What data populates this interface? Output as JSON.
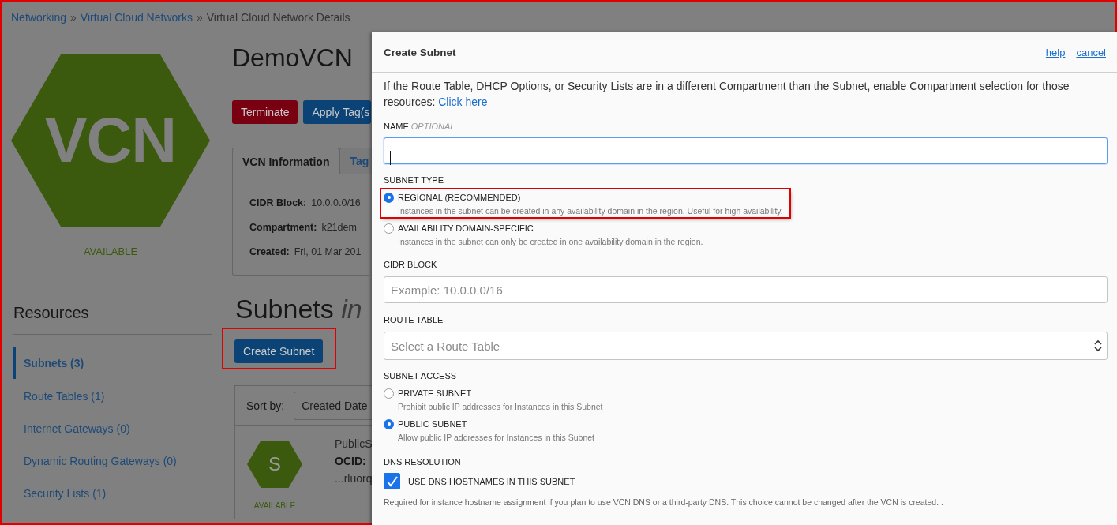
{
  "annotation_frame": true,
  "breadcrumb": [
    {
      "kind": "link",
      "text": "Networking"
    },
    {
      "kind": "separator",
      "text": "»"
    },
    {
      "kind": "link",
      "text": "Virtual Cloud Networks"
    },
    {
      "kind": "separator",
      "text": "»"
    },
    {
      "kind": "current",
      "text": "Virtual Cloud Network Details"
    }
  ],
  "vcn": {
    "logo_text": "VCN",
    "status": "AVAILABLE",
    "name": "DemoVCN",
    "actions": [
      {
        "label": "Terminate",
        "kind": "danger"
      },
      {
        "label": "Apply Tag(s",
        "kind": "primary"
      }
    ],
    "tabs": [
      {
        "label": "VCN Information",
        "selected": true
      },
      {
        "label": "Tag",
        "selected": false
      }
    ],
    "details": [
      {
        "label": "CIDR Block:",
        "value": "10.0.0.0/16"
      },
      {
        "label": "Compartment:",
        "value": "k21dem"
      },
      {
        "label": "Created:",
        "value": "Fri, 01 Mar 201"
      }
    ]
  },
  "resources": {
    "title": "Resources",
    "items": [
      {
        "label": "Subnets (3)",
        "selected": true
      },
      {
        "label": "Route Tables (1)",
        "selected": false
      },
      {
        "label": "Internet Gateways (0)",
        "selected": false
      },
      {
        "label": "Dynamic Routing Gateways (0)",
        "selected": false
      },
      {
        "label": "Security Lists (1)",
        "selected": false
      }
    ]
  },
  "subnets": {
    "title": "Subnets *in*",
    "create_button": {
      "label": "Create Subnet",
      "highlighted": true
    },
    "sort_label": "Sort by:",
    "sort_value": "Created Date",
    "rows": [
      {
        "badge": "S",
        "name": "PublicS",
        "ocid_label": "OCID:",
        "ocid": "...rluorq",
        "status": "AVAILABLE"
      }
    ]
  },
  "modal": {
    "title": "Create Subnet",
    "links": [
      "help",
      "cancel"
    ],
    "intro": "If the Route Table, DHCP Options, or Security Lists are in a different Compartment than the Subnet, enable Compartment selection for those resources:",
    "intro_link": "Click here",
    "fields": [
      {
        "kind": "text",
        "label": "NAME",
        "optional": "OPTIONAL",
        "focused": true
      },
      {
        "kind": "radio",
        "label": "SUBNET TYPE",
        "options": [
          {
            "label": "REGIONAL (RECOMMENDED)",
            "description": "Instances in the subnet can be created in any availability domain in the region. Useful for high availability.",
            "selected": true,
            "highlighted": true
          },
          {
            "label": "AVAILABILITY DOMAIN-SPECIFIC",
            "description": "Instances in the subnet can only be created in one availability domain in the region.",
            "selected": false,
            "highlighted": false
          }
        ]
      },
      {
        "kind": "text",
        "label": "CIDR BLOCK",
        "placeholder": "Example: 10.0.0.0/16",
        "focused": false
      },
      {
        "kind": "select",
        "label": "ROUTE TABLE",
        "placeholder": "Select a Route Table"
      },
      {
        "kind": "radio",
        "label": "SUBNET ACCESS",
        "options": [
          {
            "label": "PRIVATE SUBNET",
            "description": "Prohibit public IP addresses for Instances in this Subnet",
            "selected": false,
            "highlighted": false
          },
          {
            "label": "PUBLIC SUBNET",
            "description": "Allow public IP addresses for Instances in this Subnet",
            "selected": true,
            "highlighted": false
          }
        ]
      },
      {
        "kind": "checkbox",
        "label": "DNS RESOLUTION",
        "option": "USE DNS HOSTNAMES IN THIS SUBNET",
        "checked": true,
        "help": "Required for instance hostname assignment if you plan to use VCN DNS or a third-party DNS. This choice cannot be changed after the VCN is created. ."
      }
    ]
  }
}
